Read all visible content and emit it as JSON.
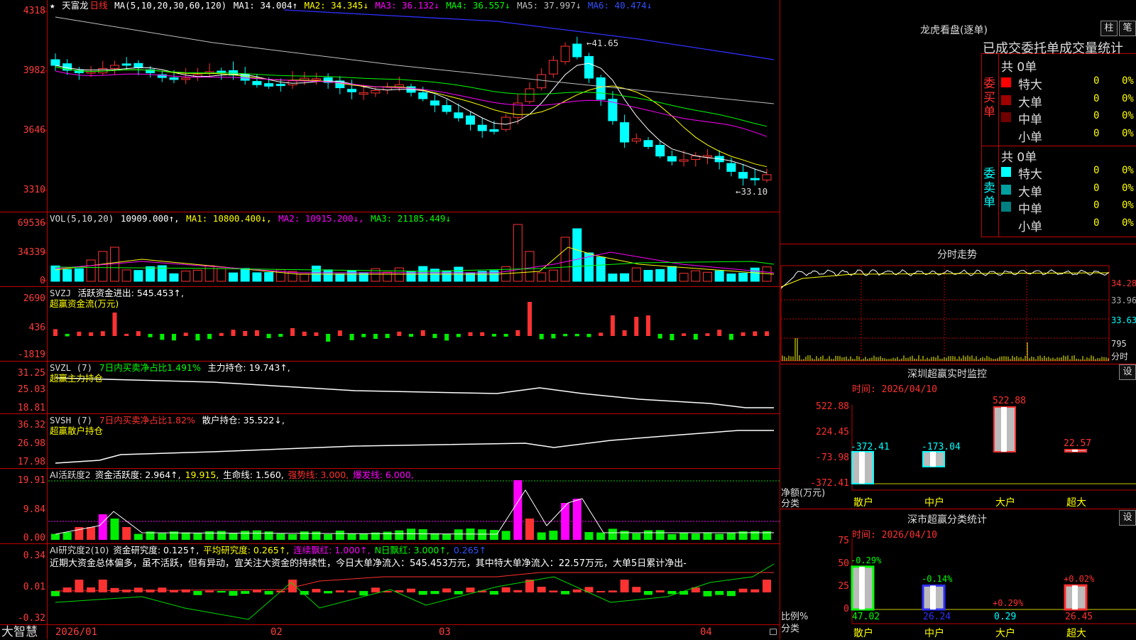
{
  "app": {
    "brand": "大智慧"
  },
  "kline": {
    "header": {
      "star": "★",
      "stock": "天富龙",
      "period": "日线",
      "ma_params": "MA(5,10,20,30,60,120)",
      "ma1": "MA1: 34.004↑",
      "ma2": "MA2: 34.345↓",
      "ma3": "MA3: 36.132↓",
      "ma4": "MA4: 36.557↓",
      "ma5": "MA5: 37.997↓",
      "ma6": "MA6: 40.474↓"
    },
    "axis": [
      "4318",
      "3982",
      "3646",
      "3310"
    ],
    "max_label": "41.65",
    "min_label": "33.10",
    "colors": {
      "up": "#ff3232",
      "down": "#00ffff",
      "ma1": "#ffffff",
      "ma2": "#ffff00",
      "ma3": "#ff00ff",
      "ma4": "#00ff00",
      "ma5": "#c0c0c0",
      "ma6": "#3030ff"
    }
  },
  "vol": {
    "header": {
      "name": "VOL(5,10,20)",
      "value": "10909.000↑,",
      "ma1": "MA1: 10800.400↓,",
      "ma2": "MA2: 10915.200↓,",
      "ma3": "MA3: 21185.449↓"
    },
    "axis": [
      "69536",
      "34339",
      "0"
    ]
  },
  "svzj": {
    "header": {
      "name": "SVZJ",
      "text": "活跃资金进出: 545.453↑,",
      "sub": "超赢资金流(万元)"
    },
    "axis": [
      "2690",
      "436",
      "-1819"
    ]
  },
  "svzl": {
    "header": {
      "name": "SVZL (7)",
      "ratio": "7日内买卖净占比1.491%",
      "main": "主力持仓: 19.743↑,",
      "sub": "超赢主力持仓"
    },
    "axis": [
      "31.25",
      "25.03",
      "18.81"
    ]
  },
  "svsh": {
    "header": {
      "name": "SVSH (7)",
      "ratio": "7日内买卖净占比1.82%",
      "retail": "散户持仓: 35.522↓,",
      "sub": "超赢散户持仓"
    },
    "axis": [
      "36.32",
      "26.98",
      "17.98"
    ]
  },
  "ai1": {
    "header": {
      "name": "AI活跃度2",
      "active": "资金活跃度: 2.964↑,",
      "val2": "19.915,",
      "life": "生命线: 1.560,",
      "strong": "强势线: 3.000,",
      "burst": "爆发线: 6.000,"
    },
    "axis": [
      "19.91",
      "9.84",
      "0.00"
    ]
  },
  "ai2": {
    "header": {
      "name": "AI研究度2(10)",
      "research": "资金研究度: 0.125↑,",
      "avg": "平均研究度: 0.265↑,",
      "streak": "连续飘红: 1.000↑,",
      "nday": "N日飘红: 3.000↑,",
      "last": "0.265↑"
    },
    "note": "近期大资金总体偏多，虽不活跃，但有异动，宜关注大资金的持续性，今日大单净流入：545.453万元，其中特大单净流入：22.57万元，大单5日累计净出-",
    "axis": [
      "0.34",
      "0.01",
      "-0.32"
    ]
  },
  "dates": [
    "2026/01",
    "02",
    "03",
    "04"
  ],
  "right": {
    "dragon": {
      "title": "龙虎看盘(逐单)",
      "btn_bar": "柱",
      "btn_pen": "笔",
      "stats_title": "已成交委托单成交量统计",
      "buy_label": "委买单",
      "sell_label": "委卖单",
      "buy_total": "共 0单",
      "sell_total": "共 0单",
      "buy": [
        {
          "label": "特大",
          "count": "0",
          "pct": "0%",
          "color": "#ff0000"
        },
        {
          "label": "大单",
          "count": "0",
          "pct": "0%",
          "color": "#a00000"
        },
        {
          "label": "中单",
          "count": "0",
          "pct": "0%",
          "color": "#700000"
        },
        {
          "label": "小单",
          "count": "0",
          "pct": "0%",
          "color": "#000000"
        }
      ],
      "sell": [
        {
          "label": "特大",
          "count": "0",
          "pct": "0%",
          "color": "#00ffff"
        },
        {
          "label": "大单",
          "count": "0",
          "pct": "0%",
          "color": "#00a0a0"
        },
        {
          "label": "中单",
          "count": "0",
          "pct": "0%",
          "color": "#008080"
        },
        {
          "label": "小单",
          "count": "0",
          "pct": "0%",
          "color": "#000000"
        }
      ]
    },
    "intraday": {
      "title": "分时走势",
      "axis": [
        "34.28",
        "33.96",
        "33.63",
        "795",
        "分时"
      ]
    },
    "sz_monitor": {
      "title": "深圳超赢实时监控",
      "settings": "设",
      "time": "时间: 2026/04/10",
      "axis": [
        "522.88",
        "224.45",
        "-73.98",
        "-372.41"
      ],
      "ylabel1": "净额(万元)",
      "ylabel2": "分类",
      "categories": [
        "散户",
        "中户",
        "大户",
        "超大"
      ],
      "values": [
        -372.41,
        -173.04,
        522.88,
        22.57
      ],
      "value_labels": [
        "-372.41",
        "-173.04",
        "522.88",
        "22.57"
      ]
    },
    "sz_class": {
      "title": "深市超赢分类统计",
      "settings": "设",
      "time": "时间: 2026/04/10",
      "axis": [
        "75",
        "50",
        "25",
        "0"
      ],
      "ylabel1": "比例%",
      "ylabel2": "分类",
      "categories": [
        "散户",
        "中户",
        "大户",
        "超大"
      ],
      "values": [
        47.02,
        26.24,
        0.29,
        26.45
      ],
      "bottom_labels": [
        "47.02",
        "26.24",
        "0.29",
        "26.45"
      ],
      "top_labels": [
        "-0.29%",
        "-0.14%",
        "+0.29%",
        "+0.02%"
      ]
    }
  }
}
